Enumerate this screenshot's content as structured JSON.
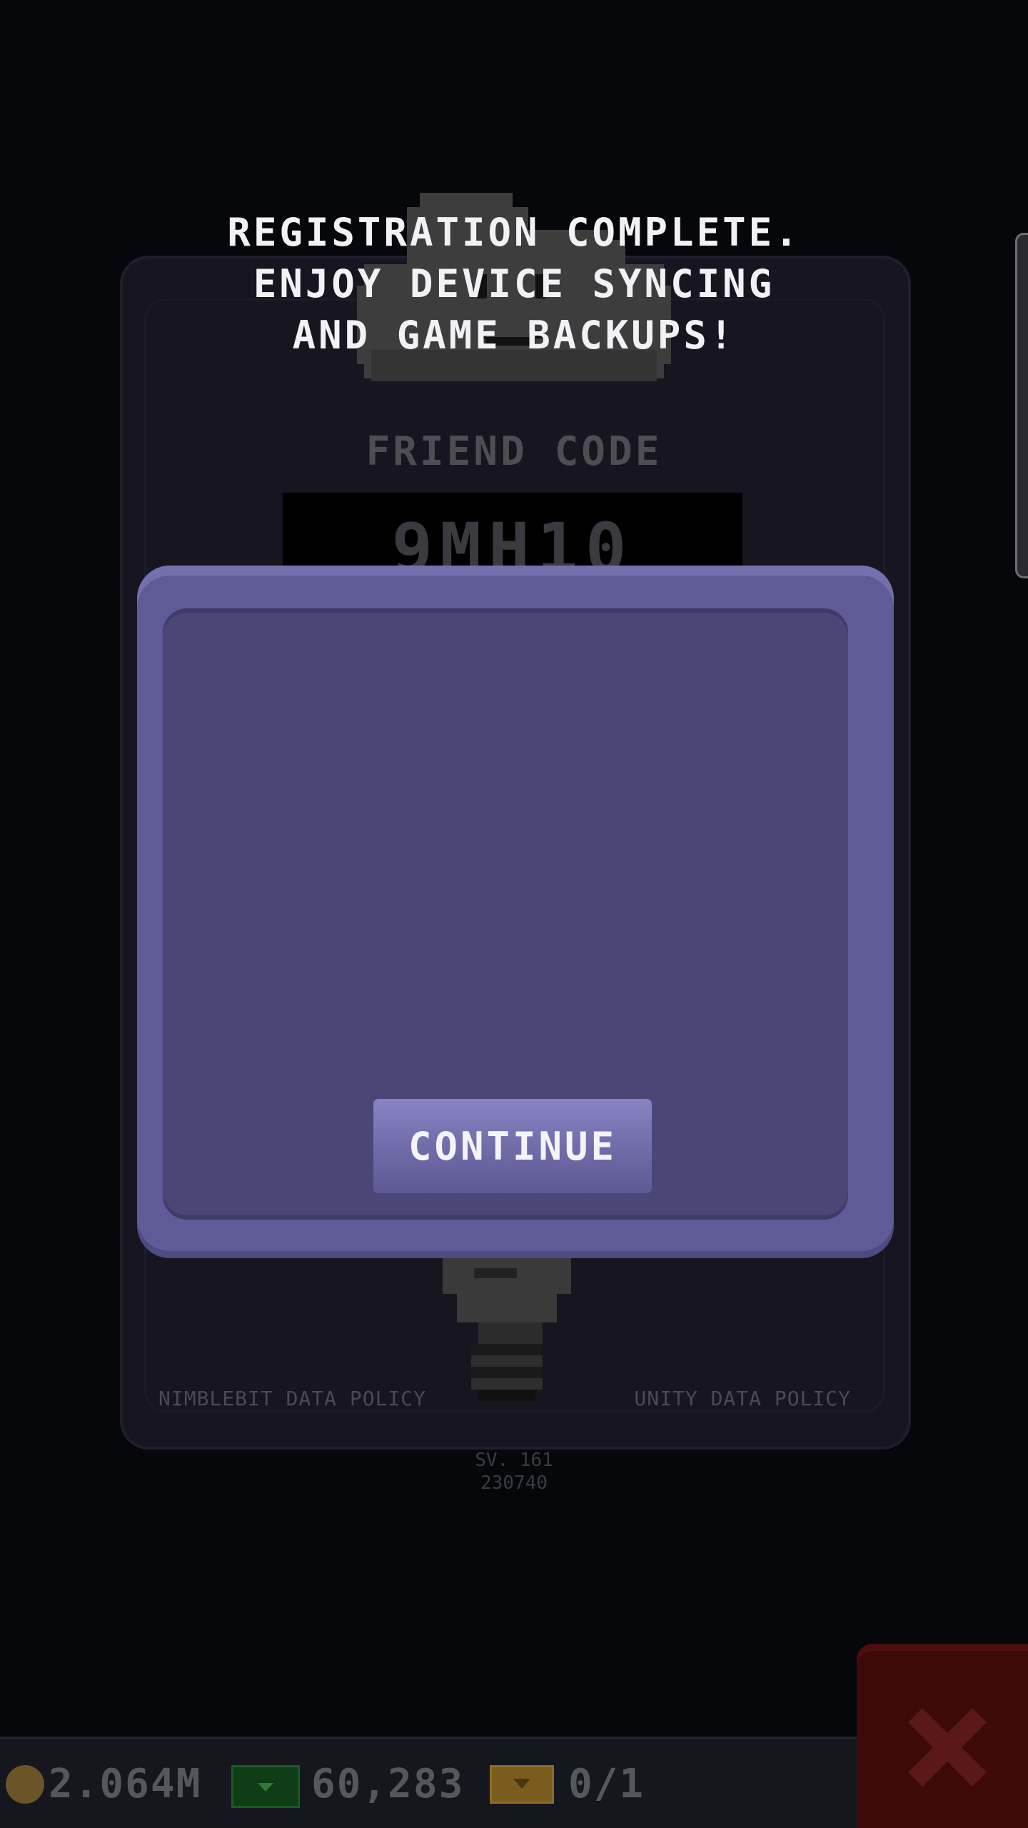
{
  "background_card": {
    "friend_code_label": "FRIEND CODE",
    "friend_code_value": "9MH10",
    "nimblebit_policy": "NIMBLEBIT DATA POLICY",
    "unity_policy": "UNITY DATA POLICY",
    "version_line1": "SV. 161",
    "version_line2": "230740"
  },
  "modal": {
    "message": "REGISTRATION COMPLETE.\nENJOY DEVICE SYNCING\nAND GAME BACKUPS!",
    "continue_label": "CONTINUE"
  },
  "status_bar": {
    "coins": "2.064M",
    "bux": "60,283",
    "tickets": "0/1"
  },
  "icons": {
    "cloud": "cloud-mascot-icon",
    "avatar": "bitizen-avatar-icon",
    "coin": "coin-icon",
    "bux": "bux-icon",
    "ticket": "ticket-icon",
    "close": "close-icon"
  },
  "colors": {
    "modal": "#5f5a98",
    "modal_inner": "#4a4676",
    "button": "#7a76b8",
    "close_button": "#3e0909"
  }
}
